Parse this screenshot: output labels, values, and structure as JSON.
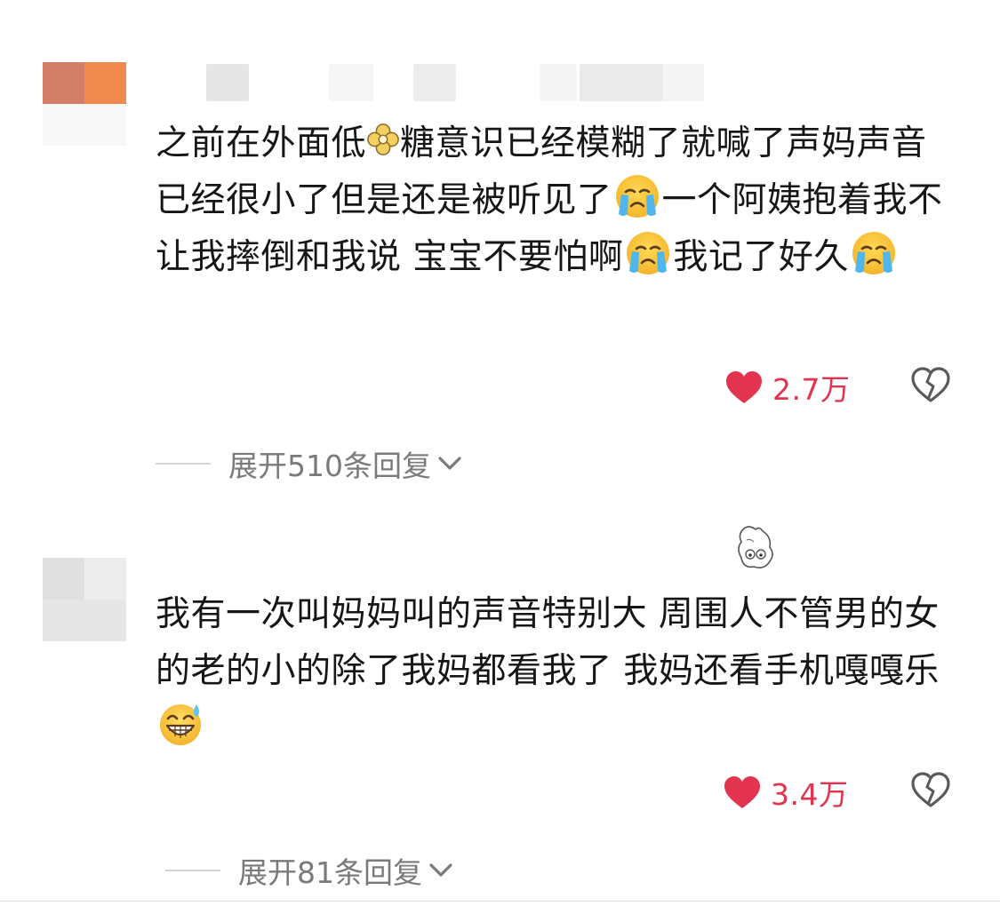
{
  "comments": [
    {
      "text_before_flower": "之前在外面低",
      "text_line1_rest": "糖意识已经模糊了就喊了声妈声音已经很小了但是还是被听见了",
      "text_mid": "一个阿姨抱着我不让我摔倒和我说 宝宝不要怕啊",
      "text_mid2": "我记了好久",
      "emoji": "crying-face",
      "likes": "2.7万",
      "replies": "展开510条回复"
    },
    {
      "text_main": "我有一次叫妈妈叫的声音特别大 周围人不管男的女的老的小的除了我妈都看我了 我妈还看手机嘎嘎乐",
      "emoji": "grinning-sweat-face",
      "likes": "3.4万",
      "replies": "展开81条回复"
    }
  ],
  "colors": {
    "like": "#e2334f",
    "text": "#161616",
    "muted": "#7a7a7a"
  }
}
